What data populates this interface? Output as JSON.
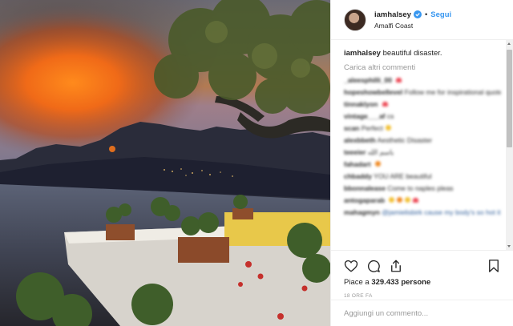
{
  "photo": {
    "description_icon": "landscape-photo"
  },
  "header": {
    "username": "iamhalsey",
    "dot": "•",
    "follow_label": "Segui",
    "location": "Amalfi Coast",
    "verified_icon": "verified-badge-icon"
  },
  "caption": {
    "username": "iamhalsey",
    "text": "beautiful disaster."
  },
  "load_more_label": "Carica altri commenti",
  "comments": [
    {
      "user": "_aleesphilli_00",
      "text": ""
    },
    {
      "user": "hopeshowbellevel",
      "text": "Follow me for inspirational quotes"
    },
    {
      "user": "tinnaklyon",
      "text": ""
    },
    {
      "user": "vintage___af",
      "text": "cs"
    },
    {
      "user": "scan",
      "text": "Perfect"
    },
    {
      "user": "alexbbeth",
      "text": "Aesthetic Disaster"
    },
    {
      "user": "teeeier",
      "text": "باسم الله"
    },
    {
      "user": "fahadart",
      "text": ""
    },
    {
      "user": "chbaddy",
      "text": "YOU ARE beautiful"
    },
    {
      "user": "bbonnalease",
      "text": "Come to naples pleas"
    },
    {
      "user": "antogaparab",
      "text": ""
    },
    {
      "user": "mahagmyn",
      "text": "@jamielisbirk cause my body's so hot it's the summer, oh yeah"
    }
  ],
  "actions": {
    "like_icon": "heart-icon",
    "comment_icon": "comment-icon",
    "share_icon": "share-icon",
    "save_icon": "bookmark-icon"
  },
  "likes": {
    "prefix": "Piace a",
    "count": "329.433",
    "suffix": "persone"
  },
  "time_label": "18 ORE FA",
  "add_comment": {
    "placeholder": "Aggiungi un commento..."
  },
  "colors": {
    "accent_blue": "#3897f0",
    "heart_red": "#ed4956",
    "muted_text": "#999999"
  }
}
